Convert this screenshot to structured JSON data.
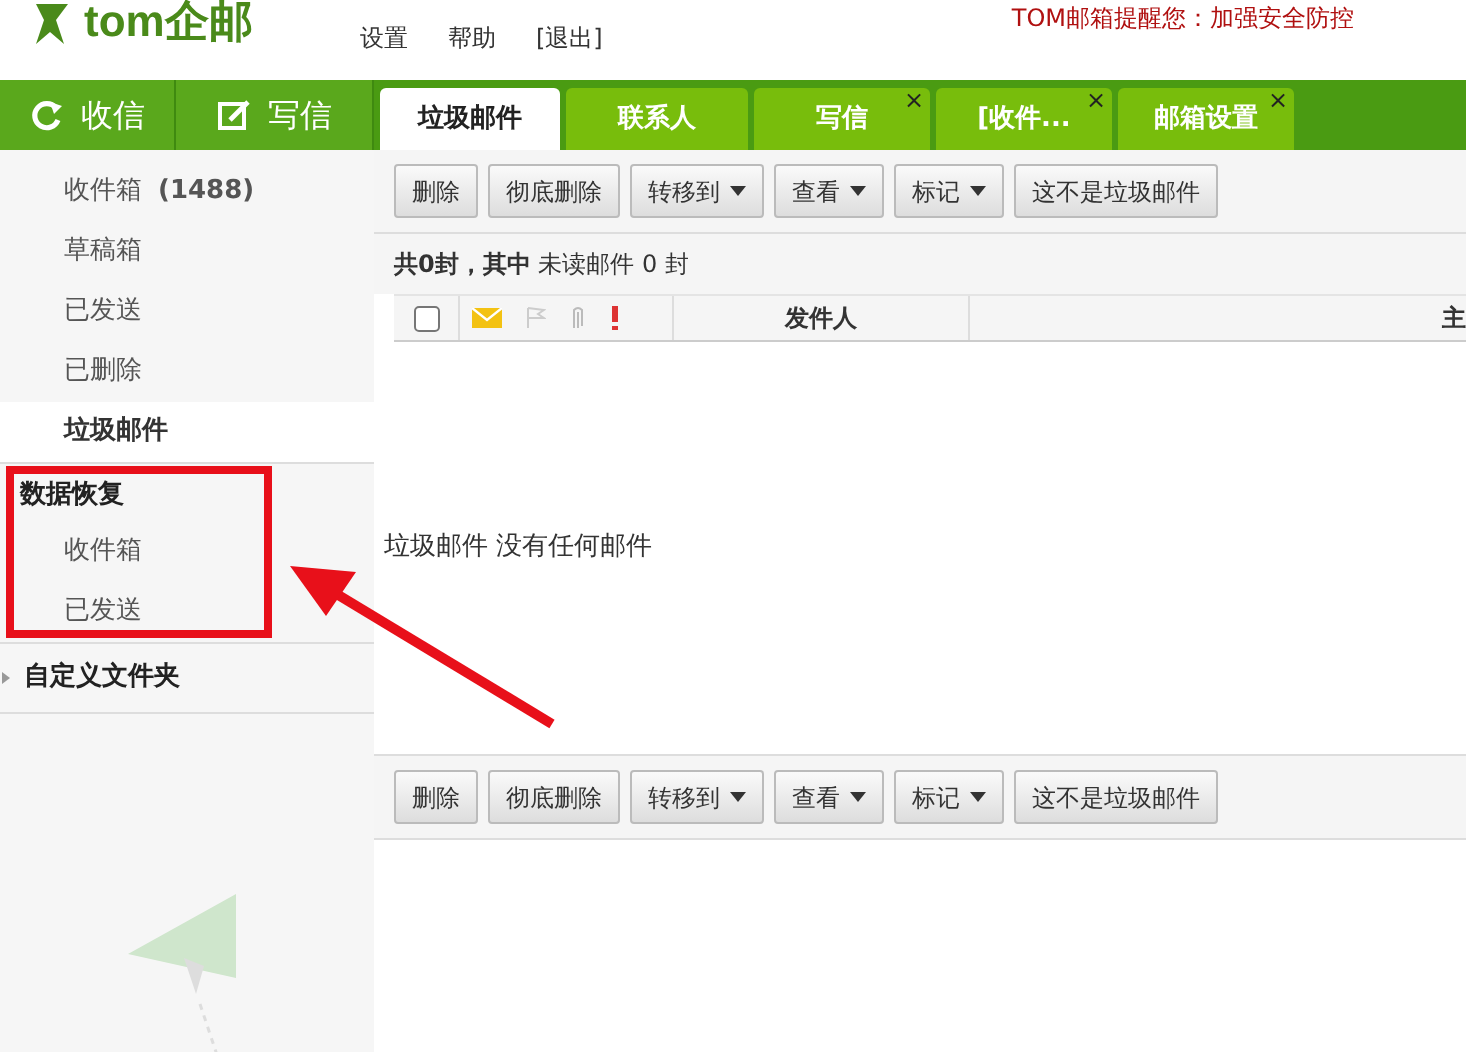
{
  "header": {
    "logo": "tom企邮",
    "links": [
      "设置",
      "帮助",
      "[退出]"
    ],
    "notice": "TOM邮箱提醒您：加强安全防控"
  },
  "nav_buttons": [
    {
      "kind": "receive",
      "label": "收信"
    },
    {
      "kind": "compose",
      "label": "写信"
    }
  ],
  "tabs": [
    {
      "label": "垃圾邮件",
      "selected": true
    },
    {
      "label": "联系人",
      "selected": false
    },
    {
      "label": "写信",
      "selected": false,
      "close": "×"
    },
    {
      "label": "[收件...",
      "selected": false,
      "close": "×"
    },
    {
      "label": "邮箱设置",
      "selected": false,
      "close": "×"
    }
  ],
  "sidebar": {
    "folders": [
      {
        "label": "收件箱",
        "count": "(1488)",
        "selected": false
      },
      {
        "label": "草稿箱",
        "selected": false
      },
      {
        "label": "已发送",
        "selected": false
      },
      {
        "label": "已删除",
        "selected": false
      },
      {
        "label": "垃圾邮件",
        "selected": true
      }
    ],
    "sections": [
      {
        "title": "数据恢复",
        "kind": "group",
        "items": [
          "收件箱",
          "已发送"
        ]
      },
      {
        "title": "自定义文件夹",
        "kind": "collapsible"
      }
    ]
  },
  "toolbar_top": [
    {
      "label": "删除",
      "kind": "button"
    },
    {
      "label": "彻底删除",
      "kind": "button"
    },
    {
      "label": "转移到",
      "kind": "dropdown"
    },
    {
      "label": "查看",
      "kind": "dropdown"
    },
    {
      "label": "标记",
      "kind": "dropdown"
    },
    {
      "label": "这不是垃圾邮件",
      "kind": "button"
    }
  ],
  "summary": "**共0封，其中** 未读邮件 0 封",
  "table": {
    "columns": [
      {
        "kind": "checkbox",
        "checked": false
      },
      {
        "kind": "icons"
      },
      {
        "kind": "text",
        "label": "发件人"
      },
      {
        "kind": "text",
        "label": "主"
      }
    ]
  },
  "empty_message": "垃圾邮件 没有任何邮件",
  "toolbar_bottom": [
    {
      "label": "删除",
      "kind": "button"
    },
    {
      "label": "彻底删除",
      "kind": "button"
    },
    {
      "label": "转移到",
      "kind": "dropdown"
    },
    {
      "label": "查看",
      "kind": "dropdown"
    },
    {
      "label": "标记",
      "kind": "dropdown"
    },
    {
      "label": "这不是垃圾邮件",
      "kind": "button"
    }
  ]
}
